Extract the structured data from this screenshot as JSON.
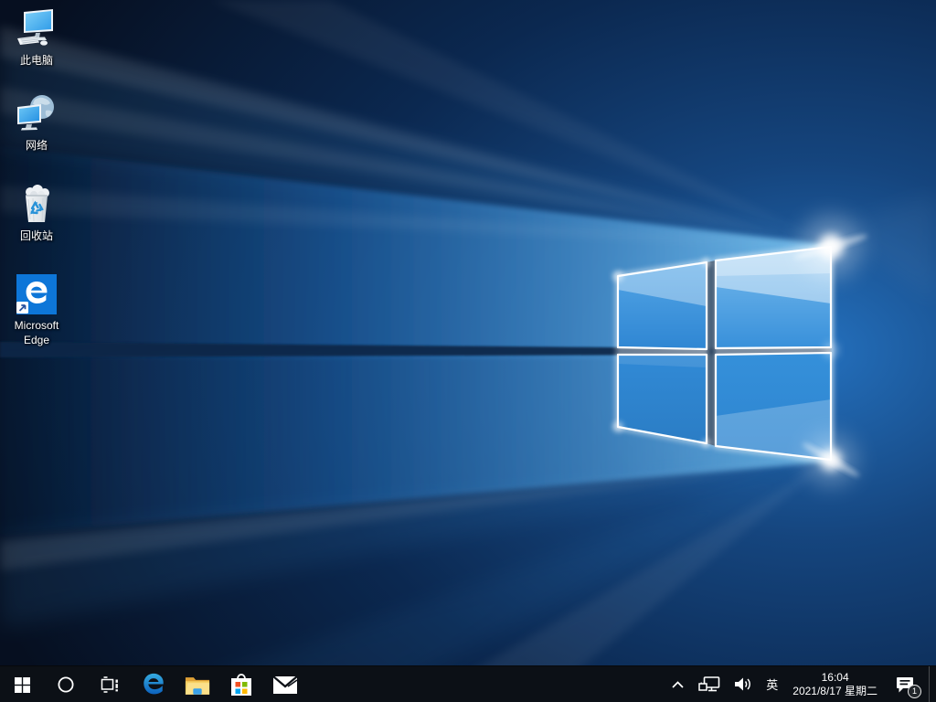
{
  "wallpaper": {
    "name": "windows-10-hero",
    "base_color": "#0a2544",
    "accent_blue": "#2e8fe0"
  },
  "desktop": {
    "icons": [
      {
        "id": "this-pc",
        "label": "此电脑"
      },
      {
        "id": "network",
        "label": "网络"
      },
      {
        "id": "recycle-bin",
        "label": "回收站"
      },
      {
        "id": "microsoft-edge",
        "label": "Microsoft Edge"
      }
    ]
  },
  "taskbar": {
    "background": "#0c1016",
    "buttons": [
      {
        "id": "start"
      },
      {
        "id": "search"
      },
      {
        "id": "task-view"
      },
      {
        "id": "edge"
      },
      {
        "id": "file-explorer"
      },
      {
        "id": "store"
      },
      {
        "id": "mail"
      }
    ],
    "tray": {
      "language": "英",
      "time": "16:04",
      "date": "2021/8/17 星期二",
      "notification_badge": "1"
    }
  },
  "colors": {
    "edge_blue": "#0d76d8",
    "folder_yellow": "#f7d064",
    "store_squares": [
      "#f25022",
      "#7fba00",
      "#00a4ef",
      "#ffb900"
    ]
  }
}
